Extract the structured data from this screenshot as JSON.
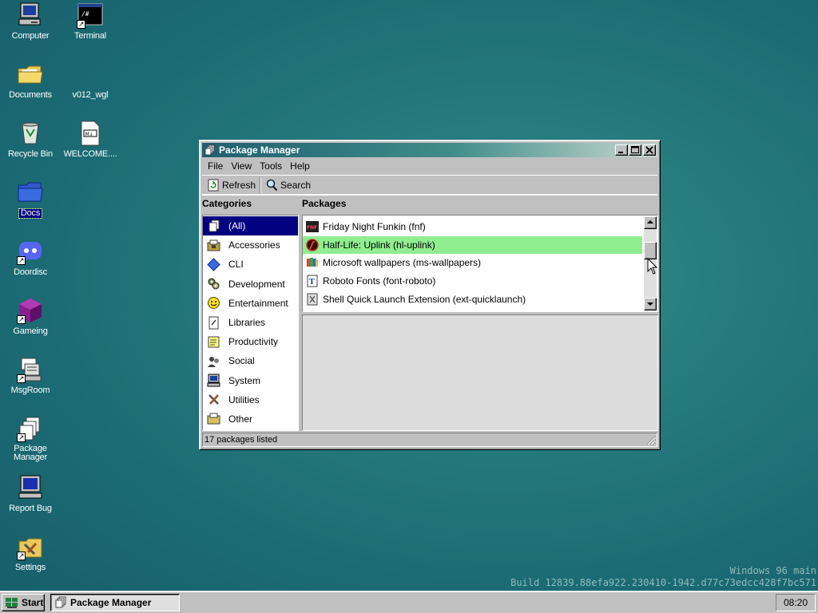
{
  "desktop": {
    "icons": [
      {
        "label": "Computer",
        "icon": "computer-icon"
      },
      {
        "label": "Terminal",
        "icon": "terminal-icon"
      },
      {
        "label": "Documents",
        "icon": "folder-icon"
      },
      {
        "label": "v012_wgl",
        "icon": "blank-file-icon"
      },
      {
        "label": "Recycle Bin",
        "icon": "recycle-bin-icon"
      },
      {
        "label": "WELCOME....",
        "icon": "markdown-file-icon"
      },
      {
        "label": "Docs",
        "icon": "blue-folder-icon"
      },
      {
        "label": "Doordisc",
        "icon": "discord-icon"
      },
      {
        "label": "Gameing",
        "icon": "purple-cube-icon"
      },
      {
        "label": "MsgRoom",
        "icon": "msgroom-icon"
      },
      {
        "label": "Package Manager",
        "icon": "package-manager-icon"
      },
      {
        "label": "Report Bug",
        "icon": "report-bug-icon"
      },
      {
        "label": "Settings",
        "icon": "settings-icon"
      }
    ]
  },
  "window": {
    "title": "Package Manager",
    "menu": [
      "File",
      "View",
      "Tools",
      "Help"
    ],
    "toolbar": {
      "refresh_label": "Refresh",
      "search_label": "Search"
    },
    "categories_label": "Categories",
    "packages_label": "Packages",
    "categories": [
      {
        "label": "(All)",
        "icon": "all-icon",
        "selected": true
      },
      {
        "label": "Accessories",
        "icon": "accessories-icon"
      },
      {
        "label": "CLI",
        "icon": "cli-diamond-icon"
      },
      {
        "label": "Development",
        "icon": "development-icon"
      },
      {
        "label": "Entertainment",
        "icon": "smiley-icon"
      },
      {
        "label": "Libraries",
        "icon": "libraries-icon"
      },
      {
        "label": "Productivity",
        "icon": "productivity-icon"
      },
      {
        "label": "Social",
        "icon": "social-icon"
      },
      {
        "label": "System",
        "icon": "system-icon"
      },
      {
        "label": "Utilities",
        "icon": "utilities-icon"
      },
      {
        "label": "Other",
        "icon": "other-icon"
      }
    ],
    "packages": [
      {
        "label": "Friday Night Funkin (fnf)",
        "icon": "fnf-icon"
      },
      {
        "label": "Half-Life: Uplink (hl-uplink)",
        "icon": "half-life-icon",
        "selected": true
      },
      {
        "label": "Microsoft wallpapers (ms-wallpapers)",
        "icon": "wallpapers-icon"
      },
      {
        "label": "Roboto Fonts (font-roboto)",
        "icon": "font-icon"
      },
      {
        "label": "Shell Quick Launch Extension (ext-quicklaunch)",
        "icon": "extension-icon"
      }
    ],
    "status": "17 packages listed"
  },
  "taskbar": {
    "start_label": "Start",
    "tasks": [
      {
        "label": "Package Manager"
      }
    ],
    "clock": "08:20"
  },
  "watermark": {
    "line1": "Windows 96 main",
    "line2": "Build 12839.88efa922.230410-1942.d77c73edcc428f7bc571"
  },
  "colors": {
    "desktop": "#257a7e",
    "selection": "#000080",
    "package_highlight": "#90ee90",
    "titlebar_start": "#1f5f6f"
  }
}
